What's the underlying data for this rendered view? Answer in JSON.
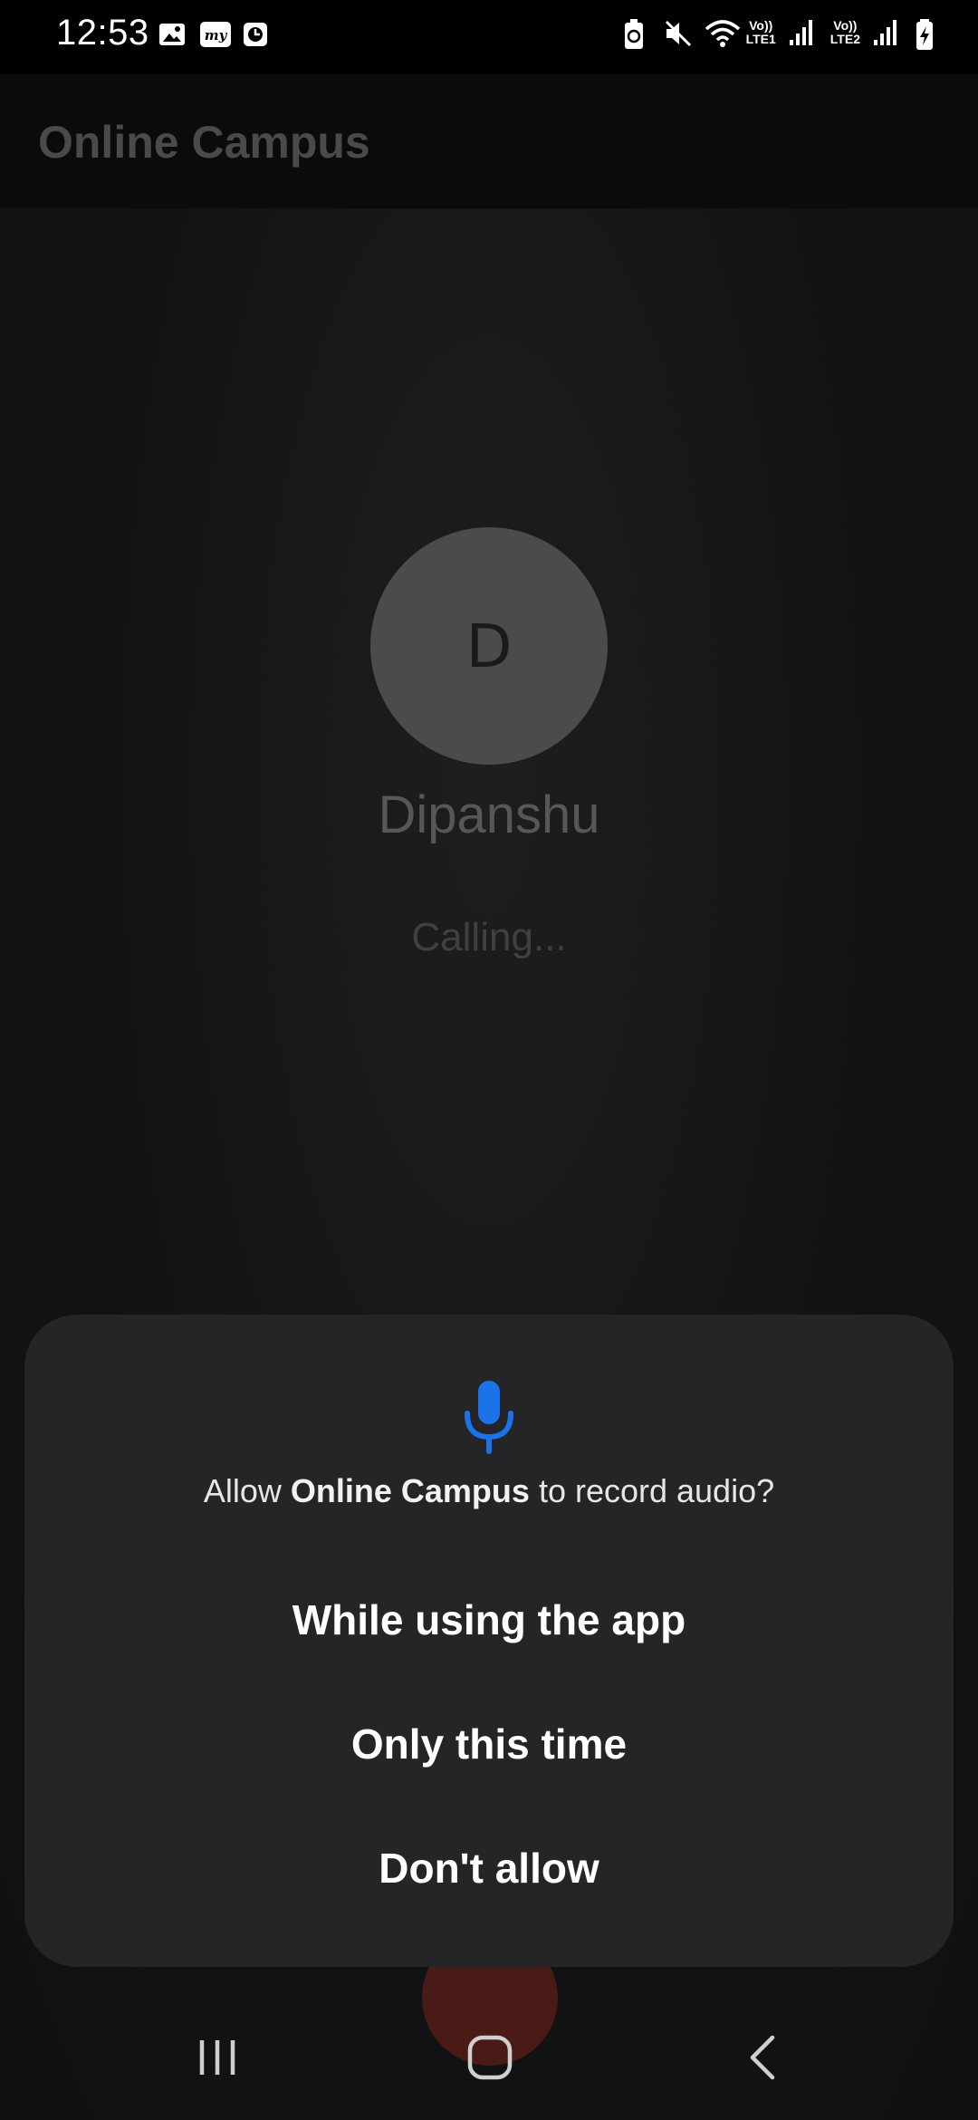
{
  "status_bar": {
    "time": "12:53",
    "left_icons": [
      "gallery-icon",
      "myntra-icon",
      "clock-app-icon"
    ],
    "right_icons": [
      "battery-saver-icon",
      "mute-icon",
      "wifi-icon",
      "signal-sim1-icon",
      "signal-sim2-icon",
      "battery-charging-icon"
    ],
    "sim1_label_top": "Vo))",
    "sim1_label_bottom": "LTE1",
    "sim2_label_top": "Vo))",
    "sim2_label_bottom": "LTE2"
  },
  "app_bar": {
    "title": "Online Campus"
  },
  "call": {
    "avatar_letter": "D",
    "caller_name": "Dipanshu",
    "status": "Calling..."
  },
  "dialog": {
    "icon": "microphone-icon",
    "question_prefix": "Allow ",
    "question_app": "Online Campus",
    "question_suffix": " to record audio?",
    "options": [
      "While using the app",
      "Only this time",
      "Don't allow"
    ],
    "accent_color": "#1a73e8"
  },
  "nav_bar": {
    "icons": [
      "recents-icon",
      "home-icon",
      "back-icon"
    ]
  }
}
